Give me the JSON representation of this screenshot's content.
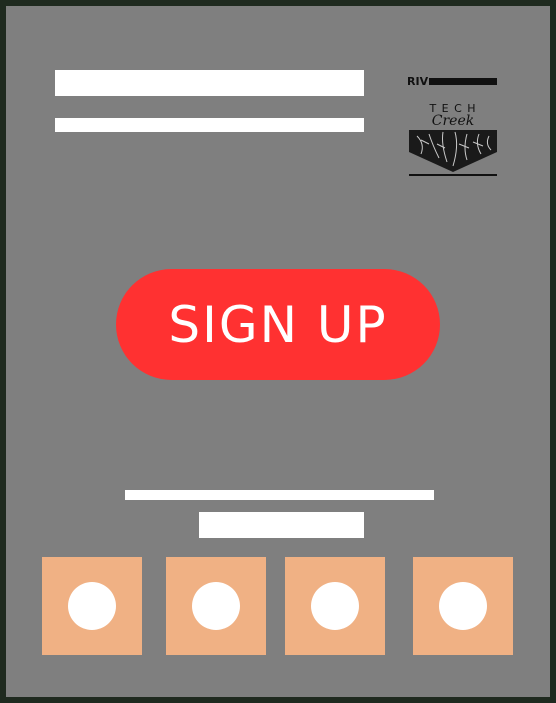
{
  "logo": {
    "prefix": "RIV",
    "wordmark": "T E C H",
    "script": "Creek",
    "icon": "tree-roots-shield-icon"
  },
  "signup": {
    "label": "SIGN UP",
    "color": "#ff3131"
  },
  "tiles": [
    {
      "icon": "circle-icon"
    },
    {
      "icon": "circle-icon"
    },
    {
      "icon": "circle-icon"
    },
    {
      "icon": "circle-icon"
    }
  ],
  "colors": {
    "background": "#7f7f7f",
    "tile": "#f0b184",
    "placeholder": "#ffffff"
  }
}
